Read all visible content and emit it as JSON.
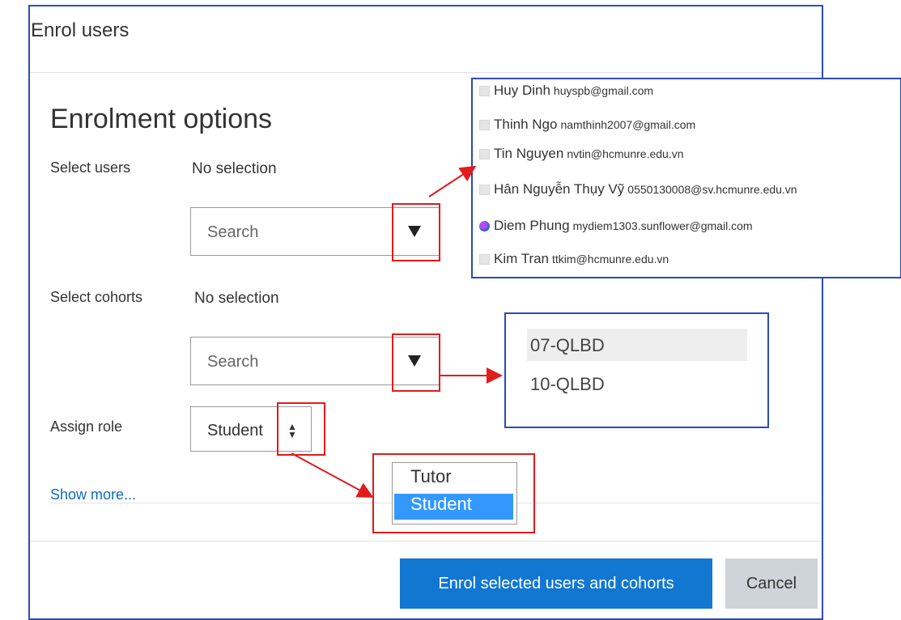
{
  "modal": {
    "title": "Enrol users",
    "section_title": "Enrolment options"
  },
  "select_users": {
    "label": "Select users",
    "value": "No selection",
    "search_placeholder": "Search"
  },
  "select_cohorts": {
    "label": "Select cohorts",
    "value": "No selection",
    "search_placeholder": "Search"
  },
  "assign_role": {
    "label": "Assign role",
    "selected": "Student",
    "options": [
      "Tutor",
      "Student"
    ]
  },
  "show_more": "Show more...",
  "footer": {
    "primary_label": "Enrol selected users and cohorts",
    "cancel_label": "Cancel"
  },
  "user_options": [
    {
      "name": "Huy Dinh",
      "email": "huyspb@gmail.com",
      "icon": "default-user-icon"
    },
    {
      "name": "Thinh Ngo",
      "email": "namthinh2007@gmail.com",
      "icon": "default-user-icon"
    },
    {
      "name": "Tin Nguyen",
      "email": "nvtin@hcmunre.edu.vn",
      "icon": "default-user-icon"
    },
    {
      "name": "Hân Nguyễn Thụy Vỹ",
      "email": "0550130008@sv.hcmunre.edu.vn",
      "icon": "default-user-icon"
    },
    {
      "name": "Diem Phung",
      "email": "mydiem1303.sunflower@gmail.com",
      "icon": "user-photo-icon"
    },
    {
      "name": "Kim Tran",
      "email": "ttkim@hcmunre.edu.vn",
      "icon": "default-user-icon"
    }
  ],
  "cohort_options": [
    "07-QLBD",
    "10-QLBD"
  ],
  "colors": {
    "primary": "#1177d1",
    "link": "#0f6cbf",
    "highlight": "#3399ff",
    "annotation_red": "#e01c1c",
    "callout_border": "#2c4ab8"
  }
}
